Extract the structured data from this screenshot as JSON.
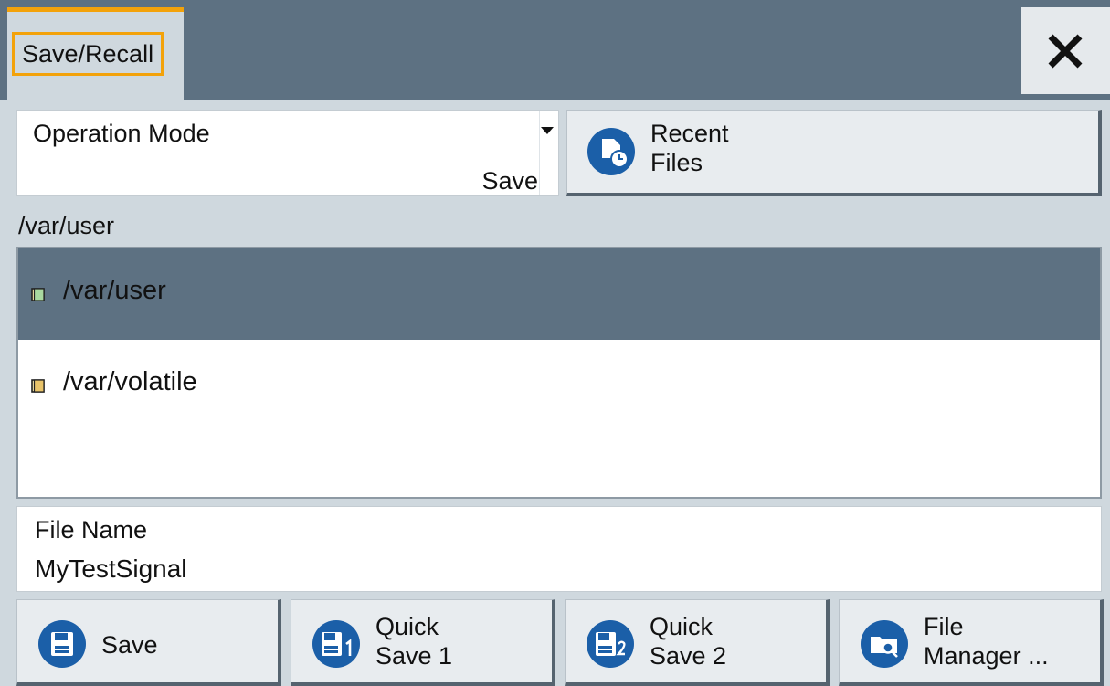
{
  "tab": {
    "label": "Save/Recall"
  },
  "operation_mode": {
    "label": "Operation Mode",
    "value": "Save"
  },
  "recent_files": {
    "line1": "Recent",
    "line2": "Files"
  },
  "current_path": "/var/user",
  "directories": [
    {
      "name": "/var/user",
      "selected": true
    },
    {
      "name": "/var/volatile",
      "selected": false
    }
  ],
  "file_name": {
    "label": "File Name",
    "value": "MyTestSignal"
  },
  "buttons": {
    "save": "Save",
    "quick_save_1": {
      "line1": "Quick",
      "line2": "Save 1"
    },
    "quick_save_2": {
      "line1": "Quick",
      "line2": "Save 2"
    },
    "file_manager": {
      "line1": "File",
      "line2": "Manager ..."
    }
  },
  "icons": {
    "close": "close-icon",
    "recent": "recent-files-icon",
    "folder": "folder-icon",
    "save": "save-icon",
    "quick1": "quick-save-1-icon",
    "quick2": "quick-save-2-icon",
    "file_manager": "file-manager-icon"
  },
  "colors": {
    "accent": "#f3a20a",
    "selection": "#5d7182",
    "icon_blue": "#1b5fa8"
  }
}
